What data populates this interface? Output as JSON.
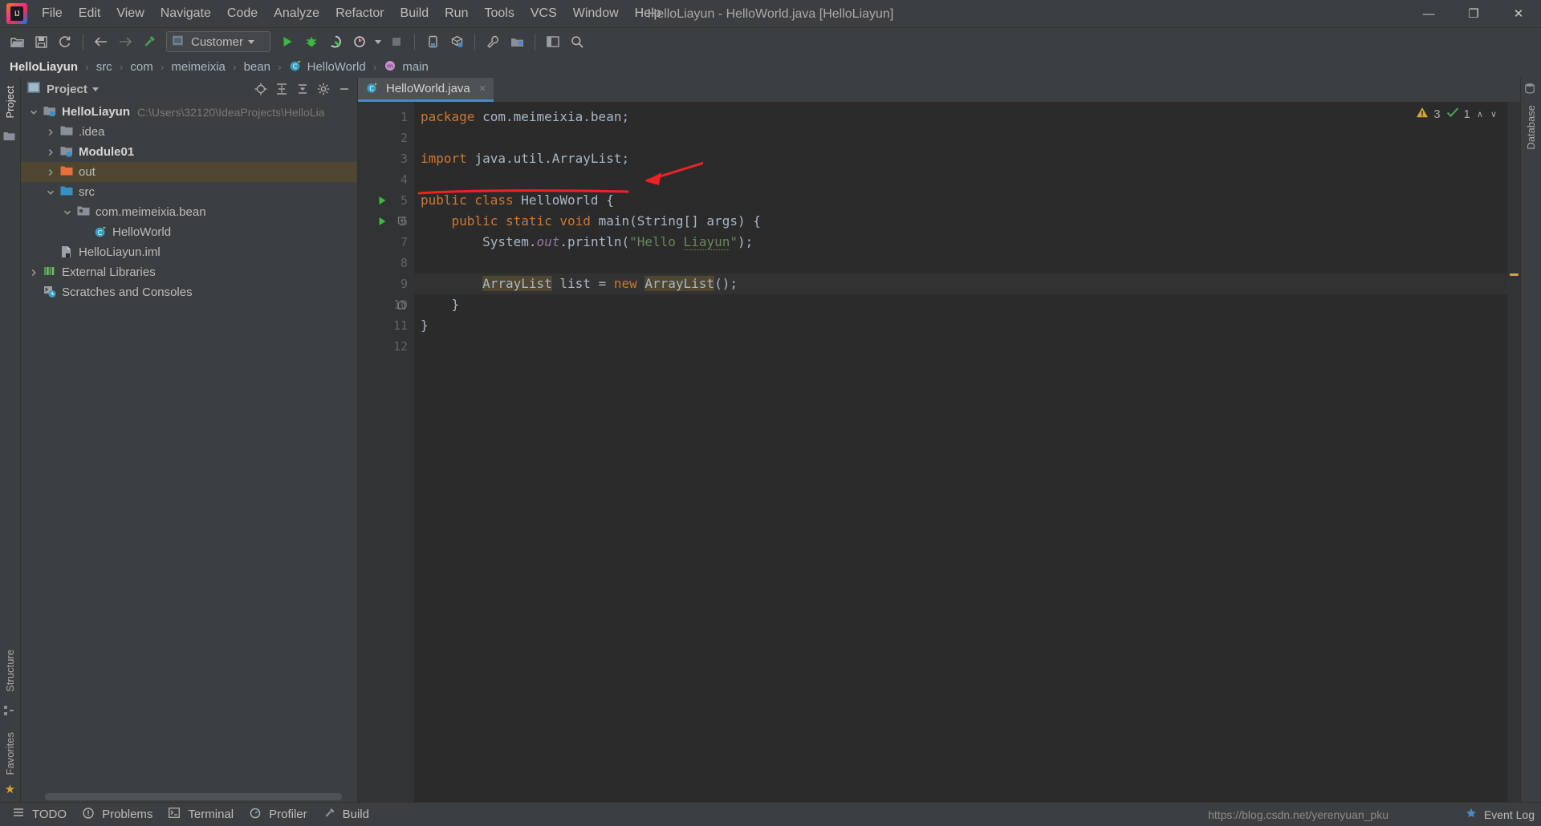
{
  "window": {
    "title": "HelloLiayun - HelloWorld.java [HelloLiayun]",
    "logo_text": "IJ",
    "minimize": "—",
    "maximize": "❐",
    "close": "✕"
  },
  "menu": {
    "items": [
      {
        "label": "File",
        "icon": "menu-file"
      },
      {
        "label": "Edit",
        "icon": "menu-edit"
      },
      {
        "label": "View",
        "icon": "menu-view"
      },
      {
        "label": "Navigate",
        "icon": "menu-navigate"
      },
      {
        "label": "Code",
        "icon": "menu-code"
      },
      {
        "label": "Analyze",
        "icon": "menu-analyze"
      },
      {
        "label": "Refactor",
        "icon": "menu-refactor"
      },
      {
        "label": "Build",
        "icon": "menu-build"
      },
      {
        "label": "Run",
        "icon": "menu-run"
      },
      {
        "label": "Tools",
        "icon": "menu-tools"
      },
      {
        "label": "VCS",
        "icon": "menu-vcs"
      },
      {
        "label": "Window",
        "icon": "menu-window"
      },
      {
        "label": "Help",
        "icon": "menu-help"
      }
    ]
  },
  "toolbar": {
    "open_icon": "open-folder-icon",
    "save_icon": "save-icon",
    "sync_icon": "sync-icon",
    "back_icon": "arrow-left-icon",
    "forward_icon": "arrow-right-icon",
    "build_icon": "hammer-icon",
    "run_config_label": "Customer",
    "run_config_icon": "module-icon",
    "run_icon": "run-icon",
    "debug_icon": "debug-icon",
    "coverage_icon": "run-coverage-icon",
    "profile_icon": "profile-icon",
    "stop_icon": "stop-icon",
    "device_icon": "device-manager-icon",
    "avd_icon": "avd-manager-icon",
    "settings_icon": "wrench-icon",
    "project-structure_icon": "project-structure-icon",
    "layout_icon": "layout-icon",
    "search_icon": "search-icon"
  },
  "breadcrumb": {
    "items": [
      {
        "label": "HelloLiayun",
        "icon": "",
        "strong": true
      },
      {
        "label": "src",
        "icon": ""
      },
      {
        "label": "com",
        "icon": ""
      },
      {
        "label": "meimeixia",
        "icon": ""
      },
      {
        "label": "bean",
        "icon": ""
      },
      {
        "label": "HelloWorld",
        "icon": "java-class-icon"
      },
      {
        "label": "main",
        "icon": "method-icon"
      }
    ],
    "separator": "›"
  },
  "left_strip": {
    "top_labels": [
      "Project"
    ],
    "bottom_labels": [
      "Structure",
      "Favorites"
    ],
    "favorite_icon": "star-icon",
    "structure_icon": "structure-icon",
    "project_folder_icon": "folder-icon"
  },
  "right_strip": {
    "labels": [
      "Database"
    ]
  },
  "project_panel": {
    "title": "Project",
    "title_icon": "project-view-icon",
    "dropdown_icon": "chevron-down-icon",
    "actions": [
      {
        "name": "locate-icon",
        "glyph": "⊕"
      },
      {
        "name": "expand-all-icon",
        "glyph": "≡"
      },
      {
        "name": "collapse-all-icon",
        "glyph": "≢"
      },
      {
        "name": "settings-gear-icon",
        "glyph": "⚙"
      },
      {
        "name": "hide-panel-icon",
        "glyph": "—"
      }
    ],
    "tree": [
      {
        "label": "HelloLiayun",
        "path": "C:\\Users\\32120\\IdeaProjects\\HelloLia",
        "indent": 0,
        "arrow": "down",
        "icon": "project-module-icon",
        "bold": true,
        "selected": false
      },
      {
        "label": ".idea",
        "path": "",
        "indent": 1,
        "arrow": "right",
        "icon": "folder-icon",
        "bold": false,
        "selected": false
      },
      {
        "label": "Module01",
        "path": "",
        "indent": 1,
        "arrow": "right",
        "icon": "module-icon",
        "bold": true,
        "selected": false
      },
      {
        "label": "out",
        "path": "",
        "indent": 1,
        "arrow": "right",
        "icon": "folder-orange-icon",
        "bold": false,
        "selected": true
      },
      {
        "label": "src",
        "path": "",
        "indent": 1,
        "arrow": "down",
        "icon": "folder-blue-icon",
        "bold": false,
        "selected": false
      },
      {
        "label": "com.meimeixia.bean",
        "path": "",
        "indent": 2,
        "arrow": "down",
        "icon": "package-icon",
        "bold": false,
        "selected": false
      },
      {
        "label": "HelloWorld",
        "path": "",
        "indent": 3,
        "arrow": "none",
        "icon": "java-class-icon",
        "bold": false,
        "selected": false
      },
      {
        "label": "HelloLiayun.iml",
        "path": "",
        "indent": 1,
        "arrow": "none",
        "icon": "iml-file-icon",
        "bold": false,
        "selected": false
      },
      {
        "label": "External Libraries",
        "path": "",
        "indent": 0,
        "arrow": "right",
        "icon": "libraries-icon",
        "bold": false,
        "selected": false
      },
      {
        "label": "Scratches and Consoles",
        "path": "",
        "indent": 0,
        "arrow": "none",
        "icon": "scratches-icon",
        "bold": false,
        "selected": false
      }
    ]
  },
  "editor": {
    "tab": {
      "label": "HelloWorld.java",
      "icon": "java-class-icon",
      "close": "×"
    },
    "inspection": {
      "warning_count": "3",
      "warning_icon": "warning-triangle-icon",
      "check_count": "1",
      "check_icon": "checkmark-icon",
      "up_chevron": "∧",
      "down_chevron": "∨"
    },
    "line_numbers": [
      "1",
      "2",
      "3",
      "4",
      "5",
      "6",
      "7",
      "8",
      "9",
      "10",
      "11",
      "12"
    ],
    "lines": [
      {
        "n": 1,
        "tokens": [
          {
            "t": "package ",
            "c": "kw"
          },
          {
            "t": "com.meimeixia.bean;",
            "c": "cls"
          }
        ],
        "highlight": false,
        "runmarker": false,
        "fold": ""
      },
      {
        "n": 2,
        "tokens": [],
        "highlight": false,
        "runmarker": false,
        "fold": ""
      },
      {
        "n": 3,
        "tokens": [
          {
            "t": "import ",
            "c": "kw"
          },
          {
            "t": "java.util.ArrayList;",
            "c": "cls"
          }
        ],
        "highlight": false,
        "runmarker": false,
        "fold": ""
      },
      {
        "n": 4,
        "tokens": [],
        "highlight": false,
        "runmarker": false,
        "fold": ""
      },
      {
        "n": 5,
        "tokens": [
          {
            "t": "public class ",
            "c": "kw"
          },
          {
            "t": "HelloWorld {",
            "c": "cls"
          }
        ],
        "highlight": false,
        "runmarker": true,
        "fold": ""
      },
      {
        "n": 6,
        "tokens": [
          {
            "t": "    public static void ",
            "c": "kw"
          },
          {
            "t": "main(String[] args) {",
            "c": "cls"
          }
        ],
        "highlight": false,
        "runmarker": true,
        "fold": "open"
      },
      {
        "n": 7,
        "tokens": [
          {
            "t": "        System.",
            "c": "cls"
          },
          {
            "t": "out",
            "c": "ital"
          },
          {
            "t": ".println(",
            "c": "cls"
          },
          {
            "t": "\"Hello Liayun\"",
            "c": "str"
          },
          {
            "t": ");",
            "c": "cls"
          }
        ],
        "highlight": false,
        "runmarker": false,
        "fold": ""
      },
      {
        "n": 8,
        "tokens": [],
        "highlight": false,
        "runmarker": false,
        "fold": ""
      },
      {
        "n": 9,
        "tokens": [
          {
            "t": "        ",
            "c": "cls"
          },
          {
            "t": "ArrayList",
            "c": "warnbg"
          },
          {
            "t": " list = ",
            "c": "cls"
          },
          {
            "t": "new ",
            "c": "kw"
          },
          {
            "t": "ArrayList",
            "c": "warnbg"
          },
          {
            "t": "();",
            "c": "cls"
          }
        ],
        "highlight": true,
        "runmarker": false,
        "fold": ""
      },
      {
        "n": 10,
        "tokens": [
          {
            "t": "    }",
            "c": "cls"
          }
        ],
        "highlight": false,
        "runmarker": false,
        "fold": "close"
      },
      {
        "n": 11,
        "tokens": [
          {
            "t": "}",
            "c": "cls"
          }
        ],
        "highlight": false,
        "runmarker": false,
        "fold": ""
      },
      {
        "n": 12,
        "tokens": [],
        "highlight": false,
        "runmarker": false,
        "fold": ""
      }
    ],
    "annotation": {
      "type": "red-arrow-underline",
      "color": "#ef2222",
      "target_line": 3,
      "note": "red underline beneath import statement with arrow pointing at it"
    }
  },
  "bottom_bar": {
    "items": [
      {
        "label": "TODO",
        "icon": "todo-icon"
      },
      {
        "label": "Problems",
        "icon": "problems-icon"
      },
      {
        "label": "Terminal",
        "icon": "terminal-icon"
      },
      {
        "label": "Profiler",
        "icon": "profiler-icon"
      },
      {
        "label": "Build",
        "icon": "build-hammer-icon"
      }
    ],
    "watermark": "https://blog.csdn.net/yerenyuan_pku",
    "event_log": {
      "label": "Event Log",
      "icon": "event-log-icon"
    }
  },
  "colors": {
    "panel_bg": "#3c3f41",
    "editor_bg": "#2b2b2b",
    "gutter_bg": "#313335",
    "keyword": "#cc7832",
    "string": "#6a8759",
    "text": "#a9b7c6",
    "selection": "#4e4631",
    "tab_underline": "#4a88c7",
    "annotation_red": "#ef2222"
  }
}
